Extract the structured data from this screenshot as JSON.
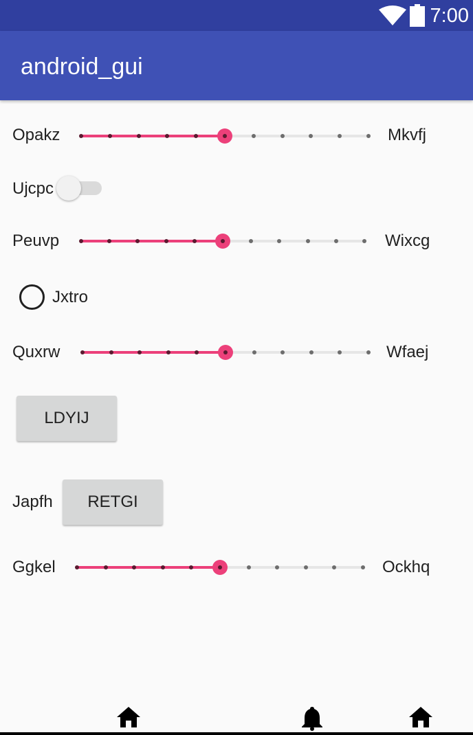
{
  "status_bar": {
    "time": "7:00",
    "icons": [
      "wifi-icon",
      "battery-icon"
    ]
  },
  "app_bar": {
    "title": "android_gui"
  },
  "content": {
    "seekbar_1": {
      "left_label": "Opakz",
      "right_label": "Mkvfj",
      "value": 5,
      "max": 10
    },
    "switch_1": {
      "label": "Ujcpc",
      "checked": false
    },
    "seekbar_2": {
      "left_label": "Peuvp",
      "right_label": "Wixcg",
      "value": 5,
      "max": 10
    },
    "radio_1": {
      "label": "Jxtro",
      "checked": false
    },
    "seekbar_3": {
      "left_label": "Quxrw",
      "right_label": "Wfaej",
      "value": 5,
      "max": 10
    },
    "button_1": {
      "label": "LDYIJ"
    },
    "row_japfh": {
      "label": "Japfh",
      "button_label": "RETGI"
    },
    "seekbar_4": {
      "left_label": "Ggkel",
      "right_label": "Ockhq",
      "value": 5,
      "max": 10
    }
  },
  "nav_bar": {
    "icons": [
      "home-icon",
      "bell-icon",
      "home-icon"
    ]
  },
  "colors": {
    "primary": "#3F51B5",
    "primary_dark": "#303F9F",
    "accent": "#EC407A",
    "background": "#FAFAFA"
  }
}
